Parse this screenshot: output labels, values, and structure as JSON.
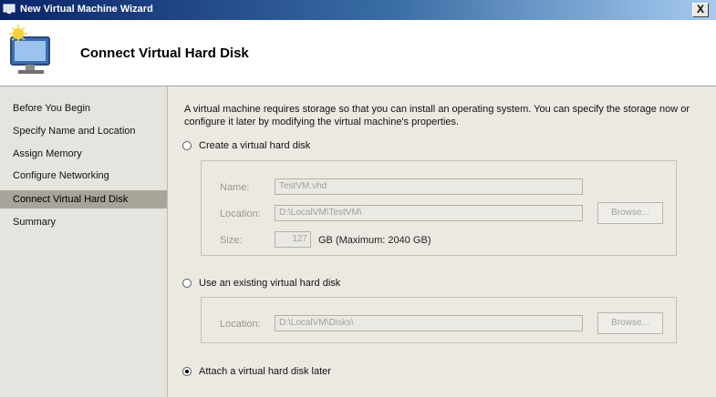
{
  "window": {
    "title": "New Virtual Machine Wizard",
    "close_label": "X"
  },
  "header": {
    "title": "Connect Virtual Hard Disk"
  },
  "sidebar": {
    "items": [
      {
        "label": "Before You Begin",
        "active": false
      },
      {
        "label": "Specify Name and Location",
        "active": false
      },
      {
        "label": "Assign Memory",
        "active": false
      },
      {
        "label": "Configure Networking",
        "active": false
      },
      {
        "label": "Connect Virtual Hard Disk",
        "active": true
      },
      {
        "label": "Summary",
        "active": false
      }
    ]
  },
  "content": {
    "description": "A virtual machine requires storage so that you can install an operating system. You can specify the storage now or configure it later by modifying the virtual machine's properties.",
    "create_option": {
      "label": "Create a virtual hard disk",
      "selected": false,
      "name_label": "Name:",
      "name_value": "TestVM.vhd",
      "location_label": "Location:",
      "location_value": "D:\\LocalVM\\TestVM\\",
      "browse_label": "Browse...",
      "size_label": "Size:",
      "size_value": "127",
      "size_unit": "GB (Maximum: 2040 GB)"
    },
    "existing_option": {
      "label": "Use an existing virtual hard disk",
      "selected": false,
      "location_label": "Location:",
      "location_value": "D:\\LocalVM\\Disks\\",
      "browse_label": "Browse..."
    },
    "later_option": {
      "label": "Attach a virtual hard disk later",
      "selected": true
    }
  }
}
